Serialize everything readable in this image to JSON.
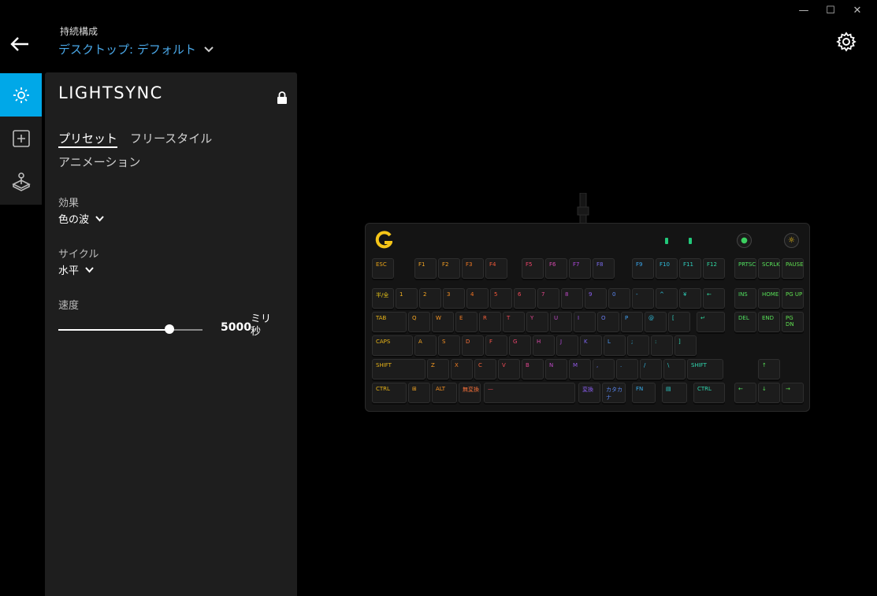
{
  "window": {
    "minimize": "—",
    "maximize": "☐",
    "close": "✕"
  },
  "header": {
    "profile_caption": "持続構成",
    "profile_name": "デスクトップ: デフォルト"
  },
  "panel": {
    "title": "LIGHTSYNC",
    "tabs": [
      "プリセット",
      "フリースタイル",
      "アニメーション"
    ],
    "effect_label": "効果",
    "effect_value": "色の波",
    "cycle_label": "サイクル",
    "cycle_value": "水平",
    "speed_label": "速度",
    "speed_value": "5000",
    "speed_unit": "ミリ秒",
    "speed_level": 0.77
  },
  "colors": {
    "accent": "#00a8e8",
    "link": "#4aa8e8",
    "logo": "#f5c518"
  },
  "icons": {
    "back": "back-arrow-icon",
    "settings": "gear-icon",
    "lighting": "sun-icon",
    "assign": "plus-box-icon",
    "game": "joystick-icon",
    "lock": "lock-icon"
  },
  "keyboard": {
    "rows": [
      [
        {
          "l": "ESC",
          "c": "#e8a317"
        },
        {
          "l": "F1",
          "c": "#f5a623"
        },
        {
          "l": "F2",
          "c": "#f59e23"
        },
        {
          "l": "F3",
          "c": "#f57b23"
        },
        {
          "l": "F4",
          "c": "#f55a3a"
        },
        {
          "l": "F5",
          "c": "#f0446a"
        },
        {
          "l": "F6",
          "c": "#d64ab0"
        },
        {
          "l": "F7",
          "c": "#b04ae0"
        },
        {
          "l": "F8",
          "c": "#7a6cf0"
        },
        {
          "l": "F9",
          "c": "#38a8f0"
        },
        {
          "l": "F10",
          "c": "#30c0e0"
        },
        {
          "l": "F11",
          "c": "#2fd0c0"
        },
        {
          "l": "F12",
          "c": "#30d8a0"
        },
        {
          "l": "PRTSC",
          "c": "#50e060"
        },
        {
          "l": "SCRLK",
          "c": "#58e058"
        },
        {
          "l": "PAUSE",
          "c": "#60e050"
        }
      ],
      [
        {
          "l": "半/全",
          "c": "#e8c417"
        },
        {
          "l": "1",
          "c": "#f5b223"
        },
        {
          "l": "2",
          "c": "#f5a623"
        },
        {
          "l": "3",
          "c": "#f59023"
        },
        {
          "l": "4",
          "c": "#f57523"
        },
        {
          "l": "5",
          "c": "#f5593a"
        },
        {
          "l": "6",
          "c": "#f04858"
        },
        {
          "l": "7",
          "c": "#e0468a"
        },
        {
          "l": "8",
          "c": "#c04ac8"
        },
        {
          "l": "9",
          "c": "#8a5ef0"
        },
        {
          "l": "0",
          "c": "#5a86f0"
        },
        {
          "l": "-",
          "c": "#38b0f0"
        },
        {
          "l": "^",
          "c": "#30c8e0"
        },
        {
          "l": "¥",
          "c": "#2fd6c0"
        },
        {
          "l": "←",
          "c": "#30dca0"
        },
        {
          "l": "INS",
          "c": "#50e060"
        },
        {
          "l": "HOME",
          "c": "#58e058"
        },
        {
          "l": "PG UP",
          "c": "#60e050"
        }
      ],
      [
        {
          "l": "TAB",
          "c": "#e8b417"
        },
        {
          "l": "Q",
          "c": "#f5a623"
        },
        {
          "l": "W",
          "c": "#f59523"
        },
        {
          "l": "E",
          "c": "#f57d23"
        },
        {
          "l": "R",
          "c": "#f5603a"
        },
        {
          "l": "T",
          "c": "#f04a58"
        },
        {
          "l": "Y",
          "c": "#e04690"
        },
        {
          "l": "U",
          "c": "#c04ac8"
        },
        {
          "l": "I",
          "c": "#9c54e8"
        },
        {
          "l": "O",
          "c": "#6a7cf0"
        },
        {
          "l": "P",
          "c": "#42a0f0"
        },
        {
          "l": "@",
          "c": "#30c4e4"
        },
        {
          "l": "[",
          "c": "#2fd4c4"
        },
        {
          "l": "↵",
          "c": "#30dca0"
        },
        {
          "l": "DEL",
          "c": "#50e060"
        },
        {
          "l": "END",
          "c": "#58e058"
        },
        {
          "l": "PG DN",
          "c": "#60e050"
        }
      ],
      [
        {
          "l": "CAPS",
          "c": "#e8b417"
        },
        {
          "l": "A",
          "c": "#f5a623"
        },
        {
          "l": "S",
          "c": "#f58f23"
        },
        {
          "l": "D",
          "c": "#f5703a"
        },
        {
          "l": "F",
          "c": "#f55448"
        },
        {
          "l": "G",
          "c": "#f04670"
        },
        {
          "l": "H",
          "c": "#d84aa8"
        },
        {
          "l": "J",
          "c": "#b04ad8"
        },
        {
          "l": "K",
          "c": "#7e66f0"
        },
        {
          "l": "L",
          "c": "#4a96f0"
        },
        {
          "l": ";",
          "c": "#32bce8"
        },
        {
          "l": ":",
          "c": "#2fd0cc"
        },
        {
          "l": "]",
          "c": "#30d8b0"
        }
      ],
      [
        {
          "l": "SHIFT",
          "c": "#e8b417"
        },
        {
          "l": "Z",
          "c": "#f59a23"
        },
        {
          "l": "X",
          "c": "#f58023"
        },
        {
          "l": "C",
          "c": "#f5623a"
        },
        {
          "l": "V",
          "c": "#f04a58"
        },
        {
          "l": "B",
          "c": "#e04690"
        },
        {
          "l": "N",
          "c": "#c04ac8"
        },
        {
          "l": "M",
          "c": "#945ae8"
        },
        {
          "l": ",",
          "c": "#6a7cf0"
        },
        {
          "l": ".",
          "c": "#42a0f0"
        },
        {
          "l": "/",
          "c": "#32bce8"
        },
        {
          "l": "\\",
          "c": "#2fd0cc"
        },
        {
          "l": "SHIFT",
          "c": "#30d8b0"
        },
        {
          "l": "↑",
          "c": "#58e058"
        }
      ],
      [
        {
          "l": "CTRL",
          "c": "#e8b417"
        },
        {
          "l": "⊞",
          "c": "#f5a623"
        },
        {
          "l": "ALT",
          "c": "#f59023"
        },
        {
          "l": "無変換",
          "c": "#f5703a"
        },
        {
          "l": "—",
          "c": "#f04a58"
        },
        {
          "l": "変換",
          "c": "#8a5ef0"
        },
        {
          "l": "カタカナ",
          "c": "#5a86f0"
        },
        {
          "l": "FN",
          "c": "#38b0f0"
        },
        {
          "l": "▤",
          "c": "#2fd0cc"
        },
        {
          "l": "CTRL",
          "c": "#30d8b0"
        },
        {
          "l": "←",
          "c": "#50e060"
        },
        {
          "l": "↓",
          "c": "#58e058"
        },
        {
          "l": "→",
          "c": "#60e050"
        }
      ]
    ]
  }
}
